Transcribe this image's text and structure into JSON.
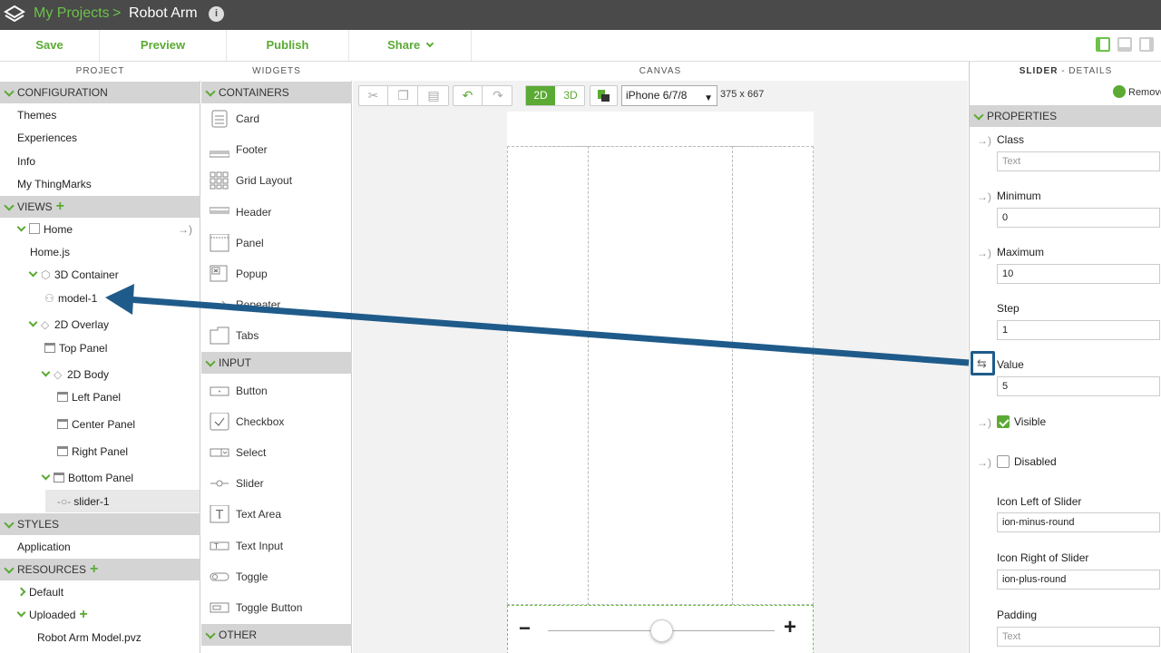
{
  "titlebar": {
    "crumb_link": "My Projects",
    "crumb_sep": ">",
    "project_name": "Robot Arm",
    "info_icon": "i"
  },
  "toolbar": {
    "save": "Save",
    "preview": "Preview",
    "publish": "Publish",
    "share": "Share",
    "share_chevron": "⌄"
  },
  "sections": {
    "project": "PROJECT",
    "widgets": "WIDGETS",
    "canvas": "CANVAS",
    "details_name": "SLIDER",
    "details_suffix": " - DETAILS"
  },
  "project": {
    "configuration": "CONFIGURATION",
    "config_items": [
      "Themes",
      "Experiences",
      "Info",
      "My ThingMarks"
    ],
    "views": "VIEWS",
    "home": "Home",
    "home_js": "Home.js",
    "container3d": "3D Container",
    "model": "model-1",
    "overlay2d": "2D Overlay",
    "top_panel": "Top Panel",
    "body2d": "2D Body",
    "left_panel": "Left Panel",
    "center_panel": "Center Panel",
    "right_panel": "Right Panel",
    "bottom_panel": "Bottom Panel",
    "slider": "slider-1",
    "styles": "STYLES",
    "application": "Application",
    "resources": "RESOURCES",
    "default": "Default",
    "uploaded": "Uploaded",
    "robot_model": "Robot Arm Model.pvz"
  },
  "widgets": {
    "containers": "CONTAINERS",
    "container_items": [
      "Card",
      "Footer",
      "Grid Layout",
      "Header",
      "Panel",
      "Popup",
      "Repeater",
      "Tabs"
    ],
    "input": "INPUT",
    "input_items": [
      "Button",
      "Checkbox",
      "Select",
      "Slider",
      "Text Area",
      "Text Input",
      "Toggle",
      "Toggle Button"
    ],
    "other": "OTHER"
  },
  "canvas": {
    "mode_2d": "2D",
    "mode_3d": "3D",
    "device": "iPhone 6/7/8",
    "dimensions": "375 x 667",
    "slider_minus": "−",
    "slider_plus": "+",
    "slider_value_fraction": 0.5
  },
  "details": {
    "remove": "Remove",
    "properties": "PROPERTIES",
    "class_label": "Class",
    "class_placeholder": "Text",
    "minimum_label": "Minimum",
    "minimum_value": "0",
    "maximum_label": "Maximum",
    "maximum_value": "10",
    "step_label": "Step",
    "step_value": "1",
    "value_label": "Value",
    "value_value": "5",
    "visible_label": "Visible",
    "disabled_label": "Disabled",
    "icon_left_label": "Icon Left of Slider",
    "icon_left_value": "ion-minus-round",
    "icon_right_label": "Icon Right of Slider",
    "icon_right_value": "ion-plus-round",
    "padding_label": "Padding",
    "padding_placeholder": "Text"
  },
  "colors": {
    "brand_green": "#5aaa33",
    "titlebar": "#4a4a4a",
    "annotation_arrow": "#1f5b8a"
  }
}
